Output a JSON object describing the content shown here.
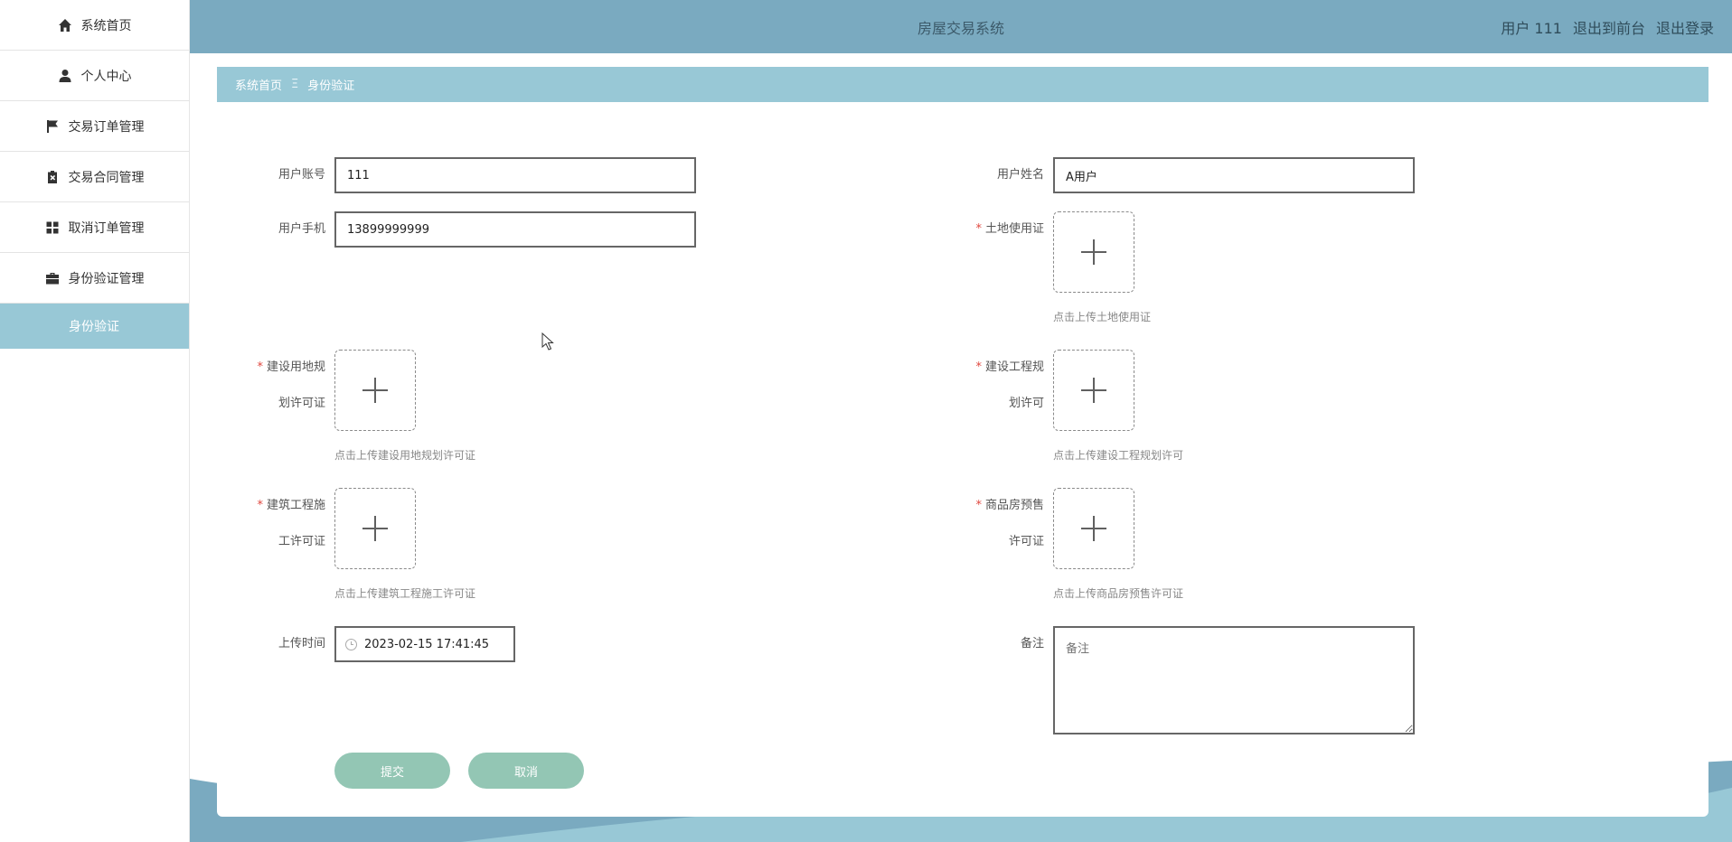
{
  "sidebar": {
    "items": [
      {
        "label": "系统首页",
        "icon": "home-icon"
      },
      {
        "label": "个人中心",
        "icon": "person-icon"
      },
      {
        "label": "交易订单管理",
        "icon": "flag-icon"
      },
      {
        "label": "交易合同管理",
        "icon": "clipboard-x-icon"
      },
      {
        "label": "取消订单管理",
        "icon": "grid-icon"
      },
      {
        "label": "身份验证管理",
        "icon": "briefcase-icon"
      }
    ],
    "active_sub": "身份验证"
  },
  "header": {
    "title": "房屋交易系统",
    "user_label": "用户 111",
    "to_front": "退出到前台",
    "logout": "退出登录"
  },
  "breadcrumb": {
    "home": "系统首页",
    "separator": "Ξ",
    "current": "身份验证"
  },
  "form": {
    "account": {
      "label": "用户账号",
      "value": "111"
    },
    "name": {
      "label": "用户姓名",
      "value": "A用户"
    },
    "phone": {
      "label": "用户手机",
      "value": "13899999999"
    },
    "land_cert": {
      "label": "土地使用证",
      "hint": "点击上传土地使用证"
    },
    "land_plan": {
      "label_line1": "建设用地规",
      "label_line2": "划许可证",
      "hint": "点击上传建设用地规划许可证"
    },
    "project_plan": {
      "label_line1": "建设工程规",
      "label_line2": "划许可",
      "hint": "点击上传建设工程规划许可"
    },
    "construction": {
      "label_line1": "建筑工程施",
      "label_line2": "工许可证",
      "hint": "点击上传建筑工程施工许可证"
    },
    "presale": {
      "label_line1": "商品房预售",
      "label_line2": "许可证",
      "hint": "点击上传商品房预售许可证"
    },
    "upload_time": {
      "label": "上传时间",
      "value": "2023-02-15 17:41:45"
    },
    "remark": {
      "label": "备注",
      "placeholder": "备注"
    },
    "submit": "提交",
    "cancel": "取消"
  },
  "colors": {
    "header_bg": "#7aaac0",
    "accent": "#98c8d6",
    "button": "#93c6b4",
    "required": "#e0473f"
  }
}
